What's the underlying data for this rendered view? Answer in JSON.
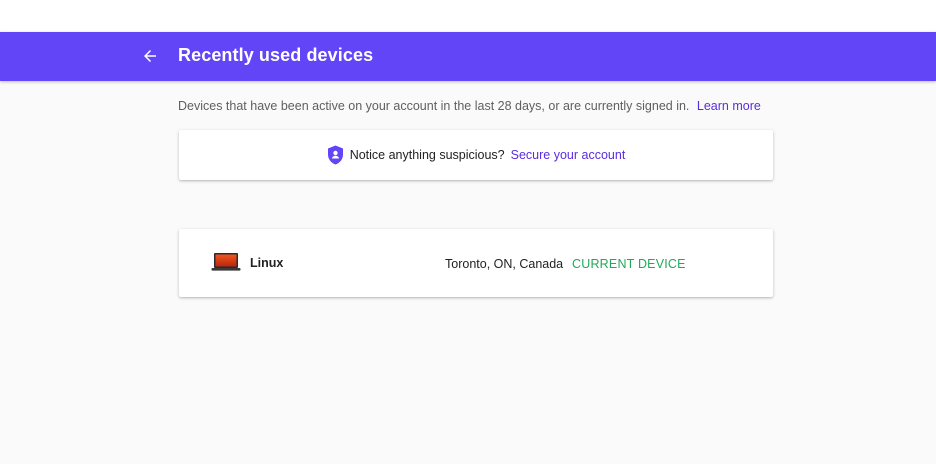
{
  "header": {
    "title": "Recently used devices",
    "back_icon": "arrow-left-icon",
    "bg_color": "#6145f7"
  },
  "description": {
    "text": "Devices that have been active on your account in the last 28 days, or are currently signed in.",
    "link_label": "Learn more"
  },
  "notice": {
    "icon": "shield-user-icon",
    "text": "Notice anything suspicious?",
    "link_label": "Secure your account"
  },
  "devices": [
    {
      "icon": "laptop-icon",
      "name": "Linux",
      "location": "Toronto, ON, Canada",
      "status": "CURRENT DEVICE",
      "status_color": "#1faa59"
    }
  ],
  "colors": {
    "accent": "#6145f7",
    "link": "#5a2de0",
    "status_green": "#1faa59"
  }
}
